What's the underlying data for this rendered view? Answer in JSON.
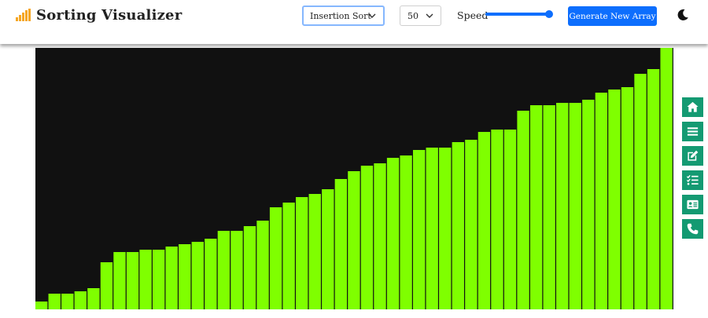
{
  "header": {
    "title": "Sorting Visualizer",
    "brand_icon": "signal-bars-icon",
    "brand_color": "#f5a623",
    "algorithm_select": {
      "selected": "Insertion Sort"
    },
    "size_select": {
      "selected": "50"
    },
    "speed": {
      "label": "Speed",
      "value_fraction": 1.0
    },
    "generate_button": {
      "label": "Generate New Array"
    },
    "theme_toggle_icon": "moon-icon"
  },
  "colors": {
    "accent": "#0d6efd",
    "bar": "#7fff00",
    "bar_border": "#111111",
    "stage_background": "#111111",
    "side_nav": "#149a72"
  },
  "array": {
    "max_value": 333,
    "values": [
      10,
      20,
      20,
      23,
      27,
      60,
      73,
      73,
      76,
      76,
      80,
      83,
      86,
      90,
      100,
      100,
      106,
      113,
      130,
      136,
      143,
      147,
      153,
      166,
      176,
      183,
      186,
      193,
      196,
      203,
      206,
      206,
      213,
      216,
      226,
      229,
      229,
      253,
      260,
      260,
      263,
      263,
      267,
      276,
      280,
      283,
      300,
      306,
      333
    ]
  },
  "side_nav": {
    "items": [
      {
        "name": "home",
        "icon": "home-icon"
      },
      {
        "name": "menu",
        "icon": "list-icon"
      },
      {
        "name": "edit",
        "icon": "edit-icon"
      },
      {
        "name": "tasks",
        "icon": "checklist-icon"
      },
      {
        "name": "profile",
        "icon": "id-card-icon"
      },
      {
        "name": "contact",
        "icon": "phone-icon"
      }
    ]
  }
}
